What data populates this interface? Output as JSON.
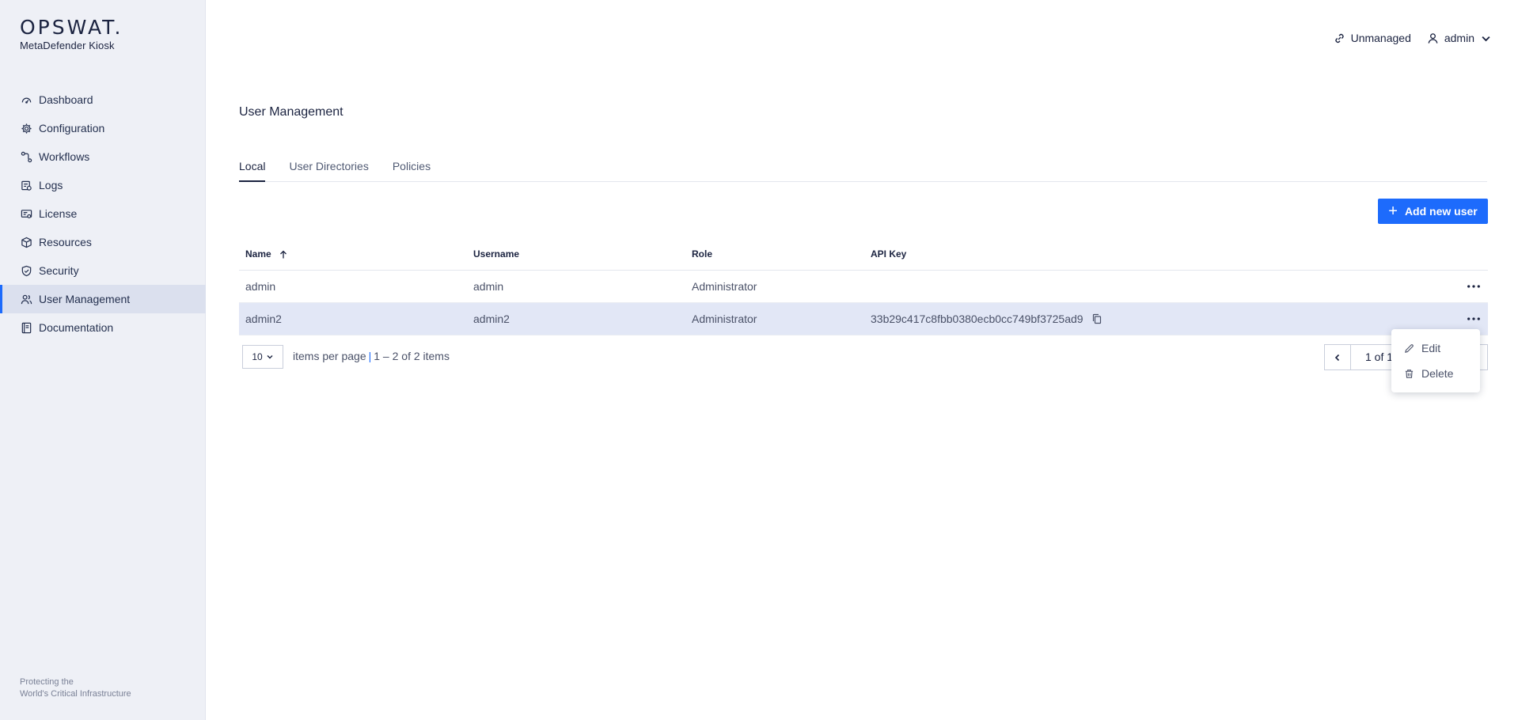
{
  "brand": {
    "logo_text": "OPSWAT.",
    "product": "MetaDefender Kiosk",
    "tagline_line1": "Protecting the",
    "tagline_line2": "World's Critical Infrastructure"
  },
  "sidebar": {
    "items": [
      {
        "label": "Dashboard",
        "icon": "dashboard-icon"
      },
      {
        "label": "Configuration",
        "icon": "gear-icon"
      },
      {
        "label": "Workflows",
        "icon": "workflow-icon"
      },
      {
        "label": "Logs",
        "icon": "logs-icon"
      },
      {
        "label": "License",
        "icon": "license-icon"
      },
      {
        "label": "Resources",
        "icon": "box-icon"
      },
      {
        "label": "Security",
        "icon": "shield-icon"
      },
      {
        "label": "User Management",
        "icon": "users-icon",
        "active": true
      },
      {
        "label": "Documentation",
        "icon": "book-icon"
      }
    ]
  },
  "header": {
    "status_label": "Unmanaged",
    "user_label": "admin"
  },
  "page": {
    "title": "User Management"
  },
  "tabs": [
    {
      "label": "Local",
      "active": true
    },
    {
      "label": "User Directories"
    },
    {
      "label": "Policies"
    }
  ],
  "actions": {
    "add_user_label": "Add new user"
  },
  "table": {
    "columns": [
      "Name",
      "Username",
      "Role",
      "API Key"
    ],
    "sorted_column": "Name",
    "sort_direction": "ascending",
    "rows": [
      {
        "name": "admin",
        "username": "admin",
        "role": "Administrator",
        "api_key": ""
      },
      {
        "name": "admin2",
        "username": "admin2",
        "role": "Administrator",
        "api_key": "33b29c417c8fbb0380ecb0cc749bf3725ad9",
        "selected": true
      }
    ]
  },
  "pagination": {
    "per_page": "10",
    "per_page_label": "items per page",
    "separator": "|",
    "range_label": "1 – 2 of 2 items",
    "page_label": "1 of 1"
  },
  "row_menu": {
    "items": [
      {
        "label": "Edit",
        "icon": "pencil-icon"
      },
      {
        "label": "Delete",
        "icon": "trash-icon"
      }
    ]
  },
  "colors": {
    "accent": "#1d6bfc",
    "sidebar_bg": "#eef0f6",
    "selected_row": "#e2e7f6"
  }
}
